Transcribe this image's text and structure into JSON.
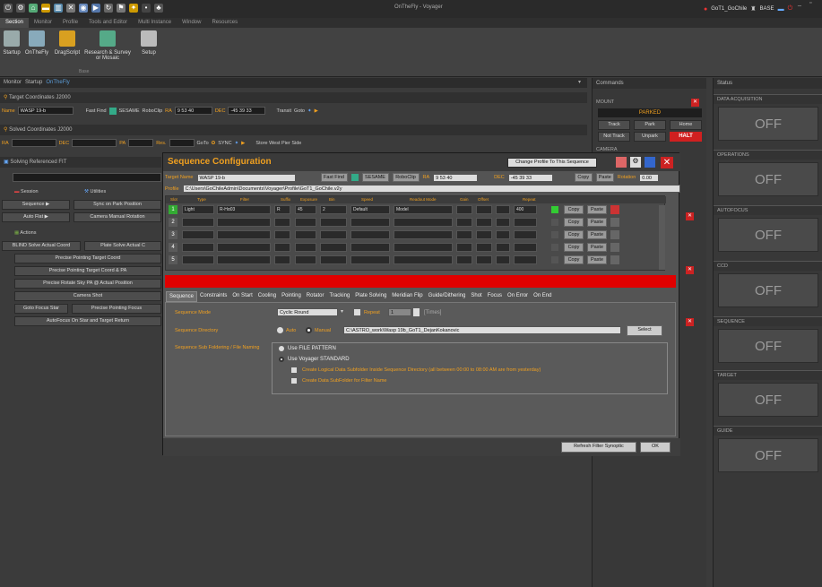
{
  "titlebar": {
    "title": "OnTheFly - Voyager",
    "account": "GoT1_GoChile",
    "base": "BASE"
  },
  "ribbon_tabs": [
    "Section",
    "Monitor",
    "Profile",
    "Tools and Editor",
    "Multi Instance",
    "Window",
    "Resources"
  ],
  "ribbon_buttons": [
    {
      "label": "Startup",
      "color": "#9aa"
    },
    {
      "label": "OnTheFly",
      "color": "#8ab"
    },
    {
      "label": "DragScript",
      "color": "#d9a020"
    },
    {
      "label": "Research & Survey or Mosaic",
      "color": "#5a8"
    },
    {
      "label": "Setup",
      "color": "#bbb"
    }
  ],
  "ribbon_group": "Base",
  "doc_tabs": [
    "Monitor",
    "Startup",
    "OnTheFly"
  ],
  "target": {
    "header": "Target Coordinates J2000",
    "name_label": "Name",
    "name_value": "WASP 19-b",
    "fast_find": "Fast Find",
    "sesame": "SESAME",
    "roboclip": "RoboClip",
    "ra_label": "RA",
    "ra_value": "9 53 40",
    "dec_label": "DEC",
    "dec_value": "-45 39 33",
    "transit": "Transit",
    "goto": "Goto"
  },
  "solved": {
    "header": "Solved Coordinates J2000",
    "ra_label": "RA",
    "dec_label": "DEC",
    "pa_label": "PA",
    "res_label": "Res.",
    "goto": "GoTo",
    "sync": "SYNC",
    "store": "Store West Pier Side"
  },
  "solving_fit": "Solving Referenced FIT",
  "left_sections": {
    "session": "Session",
    "utilities": "Utilities",
    "sequence": "Sequence",
    "sync_park": "Sync on Park Position",
    "autoflat": "Auto Flat",
    "camera_manual": "Camera Manual Rotation",
    "actions": "Actions",
    "blind": "BLIND Solve Actual Coord",
    "plate_solve": "Plate Solve Actual C",
    "action_items": [
      "Precise Pointing Target Coord",
      "Precise Pointing Target Coord & PA",
      "Precise Rotate Sky PA @ Actual Position",
      "Camera Shot"
    ],
    "goto_focus": "Goto Focus Star",
    "precise_focus": "Precise Pointing Focus",
    "autofocus_return": "AutoFocus On Star and Target Return"
  },
  "commands": {
    "header": "Commands",
    "mount": "MOUNT",
    "parked": "PARKED",
    "track": "Track",
    "park": "Park",
    "home": "Home",
    "not_track": "Not Track",
    "unpark": "Unpark",
    "halt": "HALT",
    "camera": "CAMERA"
  },
  "status": {
    "header": "Status",
    "items": [
      {
        "name": "DATA ACQUISITION",
        "value": "OFF"
      },
      {
        "name": "OPERATIONS",
        "value": "OFF"
      },
      {
        "name": "AUTOFOCUS",
        "value": "OFF"
      },
      {
        "name": "CCD",
        "value": "OFF"
      },
      {
        "name": "SEQUENCE",
        "value": "OFF"
      },
      {
        "name": "TARGET",
        "value": "OFF"
      },
      {
        "name": "GUIDE",
        "value": "OFF"
      }
    ]
  },
  "dialog": {
    "title": "Sequence Configuration",
    "change_profile": "Change Profile To This Sequence",
    "target_name_label": "Target Name",
    "target_name": "WASP 19-b",
    "fast_find": "Fast Find",
    "sesame": "SESAME",
    "roboclip": "RoboClip",
    "ra_label": "RA",
    "ra_value": "9 53 40",
    "dec_label": "DEC",
    "dec_value": "-45 39 33",
    "copy": "Copy",
    "paste": "Paste",
    "rotation_label": "Rotation",
    "rotation_value": "0.00",
    "profile_label": "Profile",
    "profile_path": "C:\\Users\\GoChileAdmin\\Documents\\Voyager\\Profile\\GoT1_GoChile.v2y",
    "columns": [
      "Slot",
      "Type",
      "Filter",
      "Suffix",
      "Exposure",
      "Bin",
      "Speed",
      "Readout Mode",
      "Gain",
      "Offset",
      "Repeat"
    ],
    "rows": [
      {
        "n": "1",
        "type": "Light",
        "filter": "R-Hα03",
        "suffix": "R",
        "exp": "45",
        "bin": "2",
        "speed": "Default",
        "readout": "Model",
        "repeat": "400"
      },
      {
        "n": "2",
        "type": "",
        "filter": "",
        "suffix": "",
        "exp": "",
        "bin": "",
        "speed": "",
        "readout": "",
        "repeat": ""
      },
      {
        "n": "3",
        "type": "",
        "filter": "",
        "suffix": "",
        "exp": "",
        "bin": "",
        "speed": "",
        "readout": "",
        "repeat": ""
      },
      {
        "n": "4",
        "type": "",
        "filter": "",
        "suffix": "",
        "exp": "",
        "bin": "",
        "speed": "",
        "readout": "",
        "repeat": ""
      },
      {
        "n": "5",
        "type": "",
        "filter": "",
        "suffix": "",
        "exp": "",
        "bin": "",
        "speed": "",
        "readout": "",
        "repeat": ""
      }
    ],
    "row_copy": "Copy",
    "row_paste": "Paste",
    "tabs": [
      "Sequence",
      "Constraints",
      "On Start",
      "Cooling",
      "Pointing",
      "Rotator",
      "Tracking",
      "Plate Solving",
      "Meridian Flip",
      "Guide/Dithering",
      "Shot",
      "Focus",
      "On Error",
      "On End"
    ],
    "seq_mode_label": "Sequence Mode",
    "seq_mode": "Cyclic Round",
    "repeat_label": "Repeat",
    "repeat_value": "1",
    "times": "[Times]",
    "seq_dir_label": "Sequence Directory",
    "auto": "Auto",
    "manual": "Manual",
    "seq_dir": "C:\\ASTRO_work\\Wasp 19b_GoT1_DejanKokanovic",
    "select": "Select",
    "subfolder_label": "Sequence Sub Foldering / File Naming",
    "use_file_pattern": "Use FILE PATTERN",
    "use_voyager": "Use Voyager STANDARD",
    "create_logical": "Create Logical Data Subfolder Inside Sequence Directory (all between 00:00 to 08:00 AM are from yesterday)",
    "create_filter": "Create Data SubFolder for Filter Name",
    "refresh": "Refresh Filter Synoptic",
    "ok": "OK"
  }
}
